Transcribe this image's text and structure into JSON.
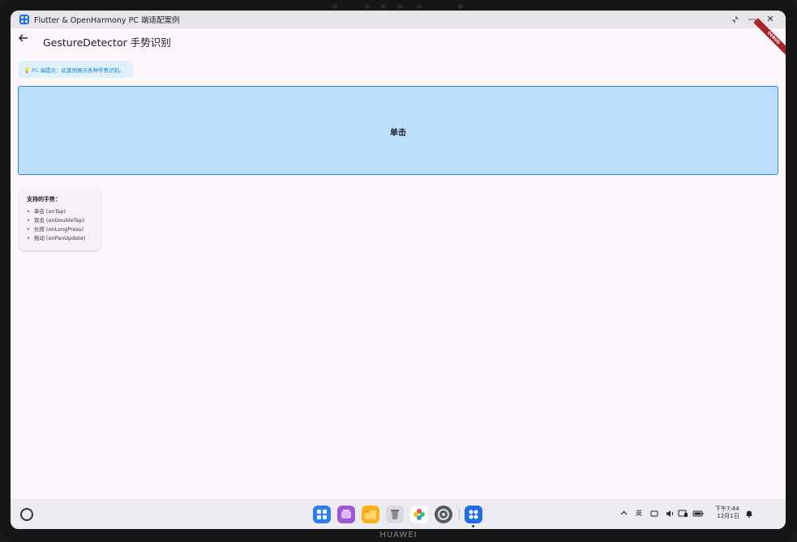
{
  "window": {
    "title": "Flutter & OpenHarmony PC 端适配案例",
    "icons": [
      "app-grid-icon",
      "restore-icon",
      "minimize-icon",
      "close-icon"
    ]
  },
  "appbar": {
    "back_icon": "arrow-left-icon",
    "title": "GestureDetector 手势识别",
    "debug_banner": "DEBUG"
  },
  "tip": {
    "icon": "lightbulb-icon",
    "text": "💡 PC 端提示：此案例展示各种手势识别。"
  },
  "gesture_area": {
    "label": "单击",
    "color": "#bbdefb"
  },
  "gestures_card": {
    "title": "支持的手势：",
    "items": [
      "单击 (onTap)",
      "双击 (onDoubleTap)",
      "长按 (onLongPress)",
      "拖动 (onPanUpdate)"
    ]
  },
  "taskbar": {
    "dock": [
      "app-center-icon",
      "multitask-icon",
      "files-icon",
      "trash-icon",
      "gallery-icon",
      "settings-icon",
      "flutter-app-icon"
    ],
    "tray": {
      "language": "英",
      "clock_time": "下午7:44",
      "clock_date": "12月1日"
    }
  },
  "device": {
    "brand": "HUAWEI"
  },
  "colors": {
    "accent": "#2f86e6",
    "tip_text": "#1e7fc8",
    "page_bg": "#fdf6fd"
  }
}
